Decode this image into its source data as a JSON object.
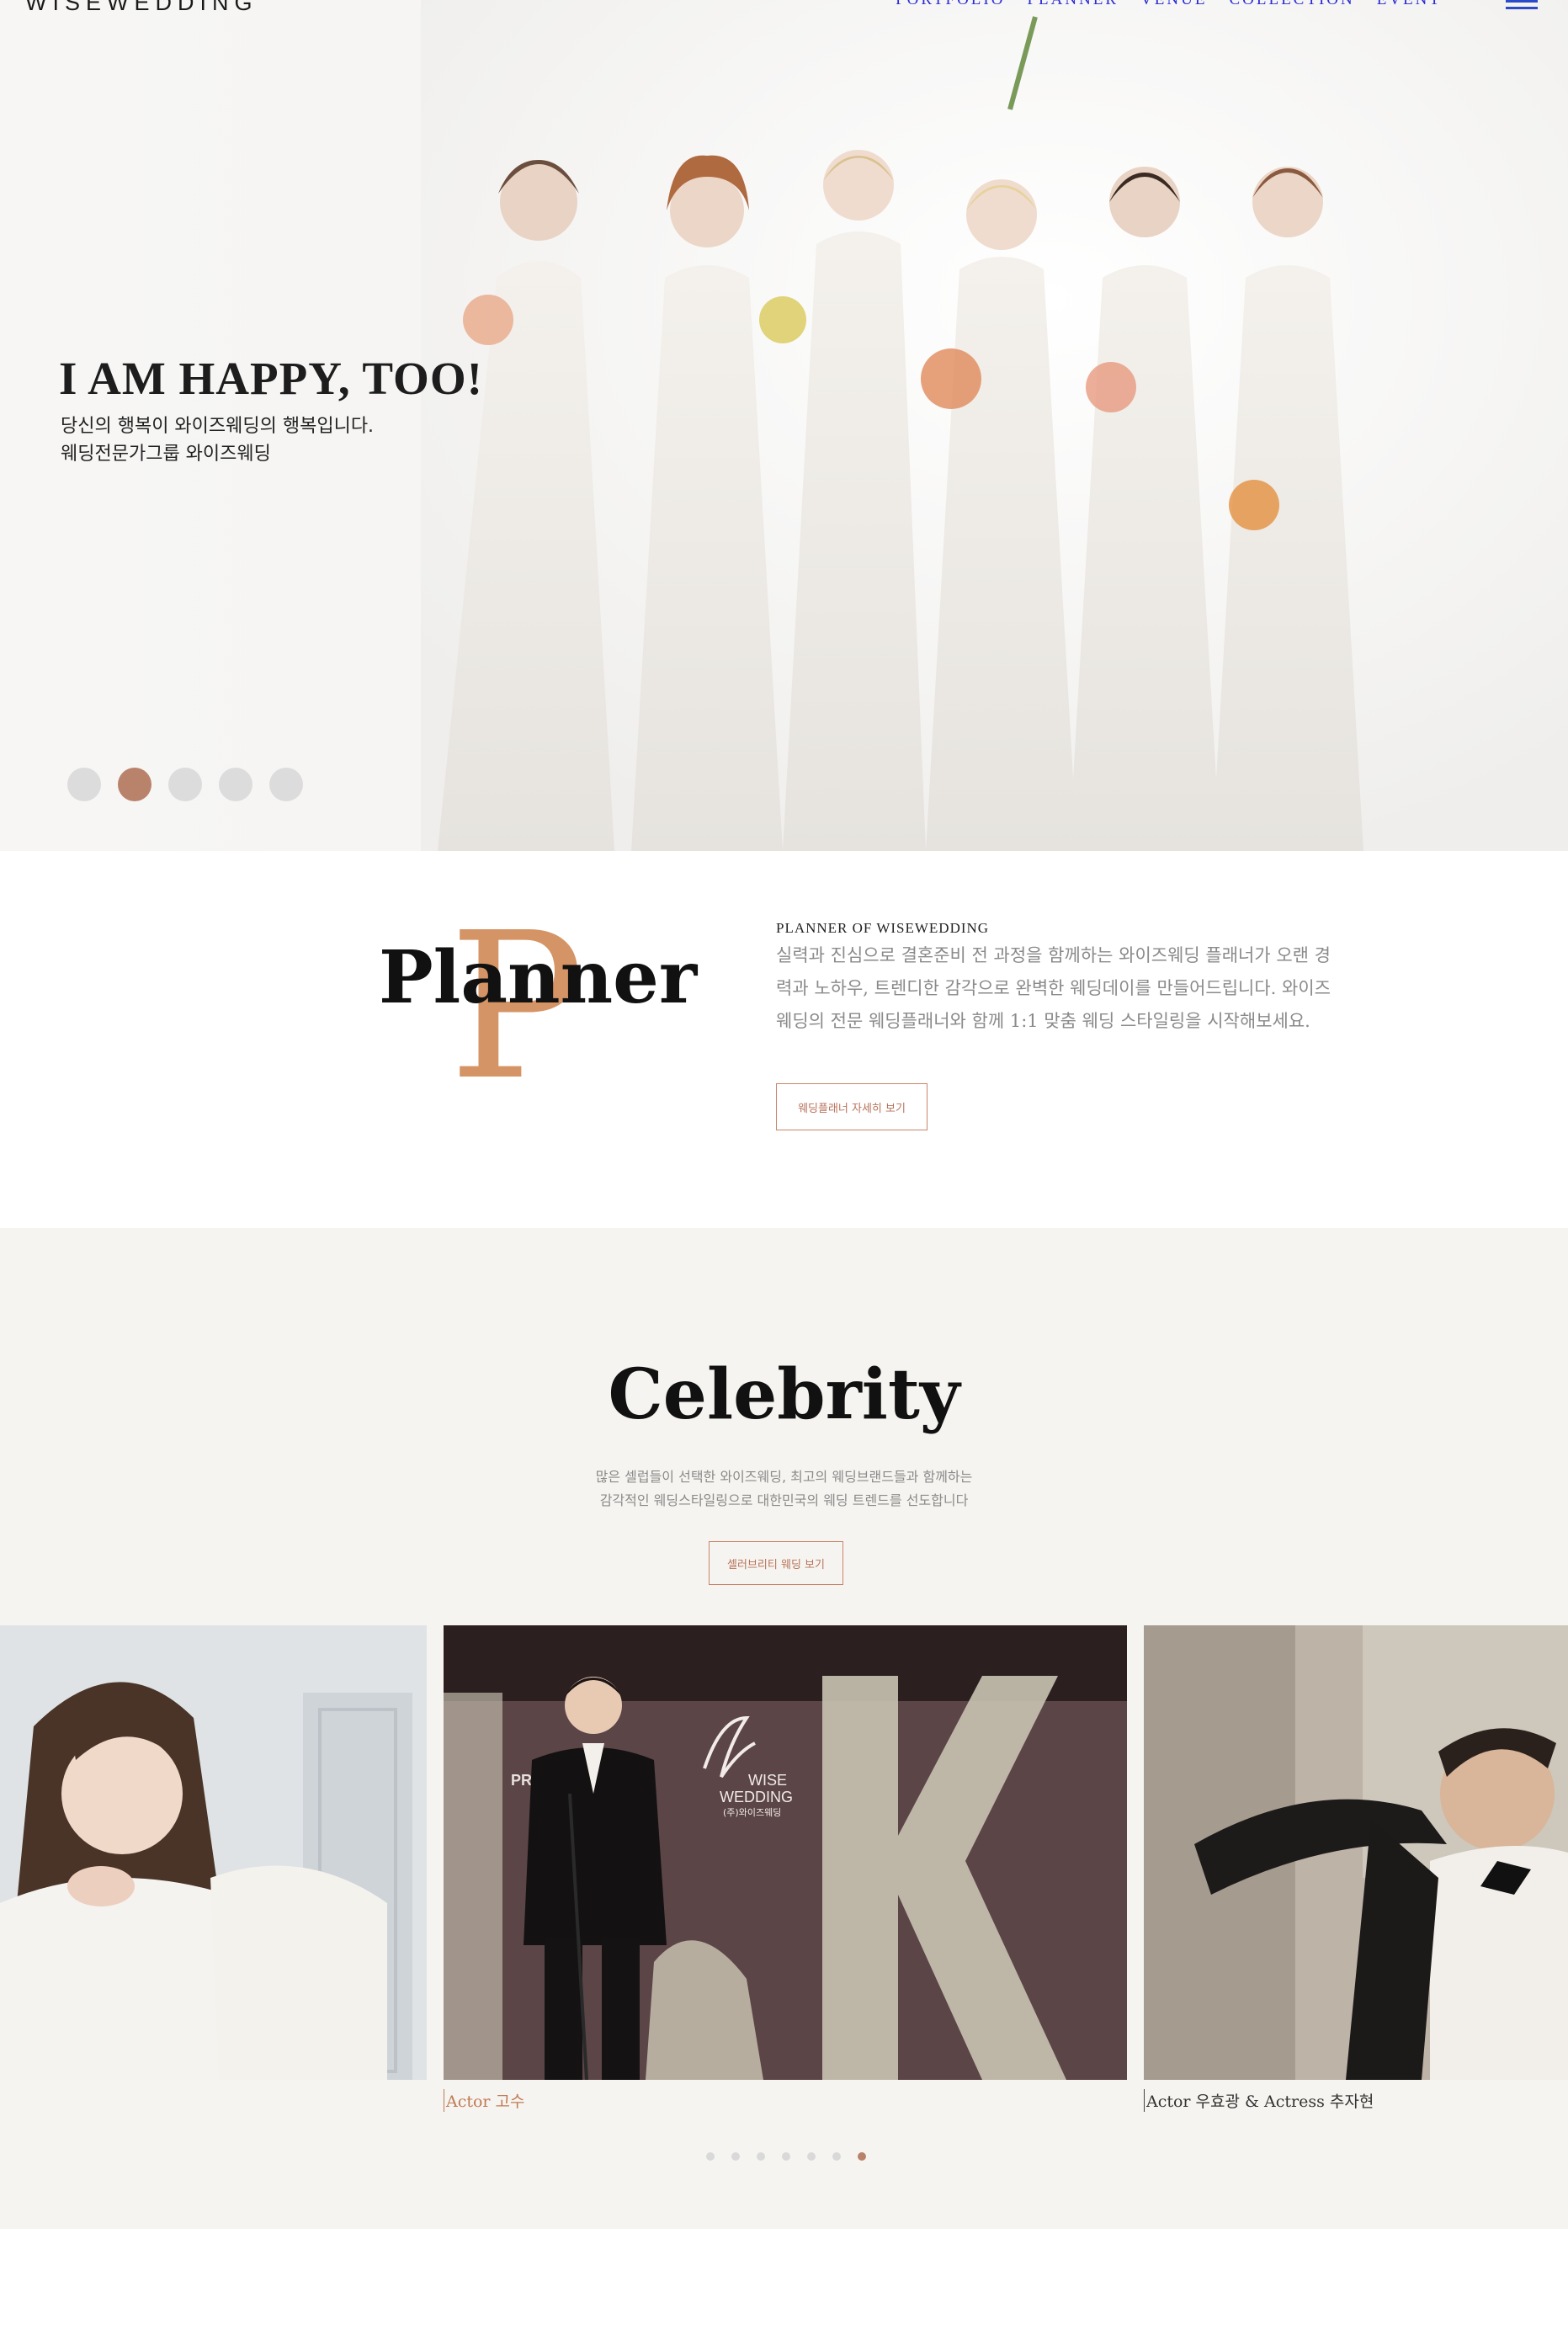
{
  "header": {
    "logo": "WISEWEDDING",
    "nav": [
      "PORTFOLIO",
      "PLANNER",
      "VENUE",
      "COLLECTION",
      "EVENT"
    ]
  },
  "hero": {
    "title": "I AM HAPPY, TOO!",
    "subtitle_line1": "당신의 행복이 와이즈웨딩의 행복입니다.",
    "subtitle_line2": "웨딩전문가그룹 와이즈웨딩",
    "slide_count": 5,
    "active_slide": 2
  },
  "planner": {
    "big_letter": "P",
    "title": "Planner",
    "kicker": "PLANNER OF WISEWEDDING",
    "description": "실력과 진심으로 결혼준비 전 과정을 함께하는 와이즈웨딩 플래너가 오랜 경력과 노하우, 트렌디한 감각으로 완벽한 웨딩데이를 만들어드립니다. 와이즈웨딩의 전문 웨딩플래너와 함께 1:1 맞춤 웨딩 스타일링을 시작해보세요.",
    "button": "웨딩플래너 자세히 보기"
  },
  "celebrity": {
    "title": "Celebrity",
    "desc_line1": "많은 셀럽들이 선택한 와이즈웨딩, 최고의 웨딩브랜드들과 함께하는",
    "desc_line2": "감각적인 웨딩스타일링으로 대한민국의 웨딩 트렌드를 선도합니다",
    "button": "셀러브리티 웨딩 보기",
    "cards": [
      {
        "caption": ""
      },
      {
        "caption": "Actor 고수",
        "sign_text": "PR",
        "logo_line1": "WISE",
        "logo_line2": "WEDDING",
        "logo_line3": "(주)와이즈웨딩"
      },
      {
        "caption": "Actor 우효광 & Actress 추자현"
      }
    ],
    "dot_count": 7,
    "active_dot": 7
  },
  "colors": {
    "accent": "#b9826b",
    "nav": "#2b2bd6",
    "celebrity_bg": "#f6f4f0"
  }
}
